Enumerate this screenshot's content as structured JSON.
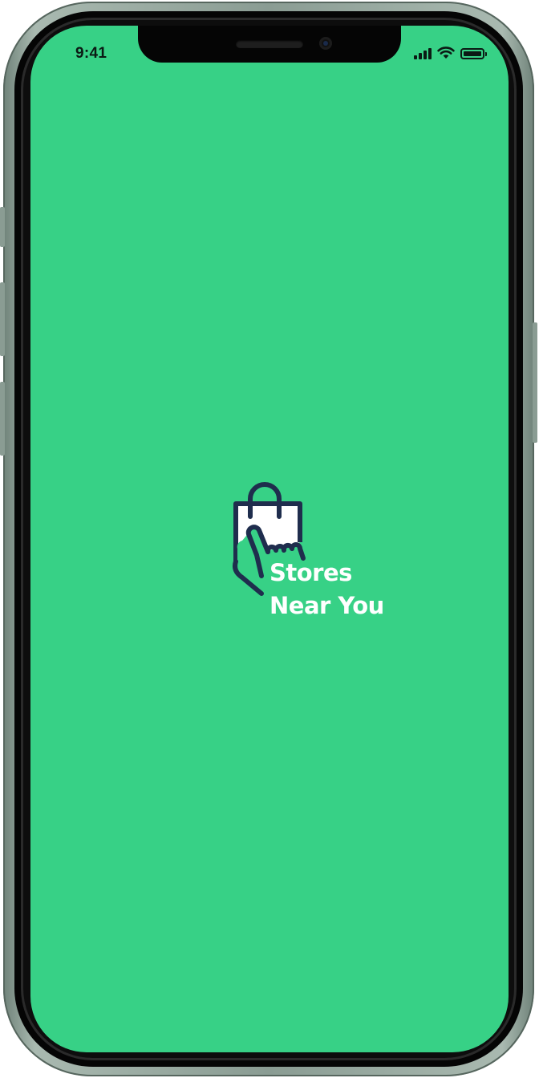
{
  "status_bar": {
    "time": "9:41",
    "icons": [
      "signal-icon",
      "wifi-icon",
      "battery-icon"
    ],
    "battery_level": 1.0
  },
  "splash": {
    "background_color": "#37d186",
    "logo_icon": "shopping-bag-hand-icon",
    "logo_stroke_color": "#1f2d4d",
    "title_line1": "Stores",
    "title_line2": "Near You",
    "text_color": "#ffffff"
  }
}
